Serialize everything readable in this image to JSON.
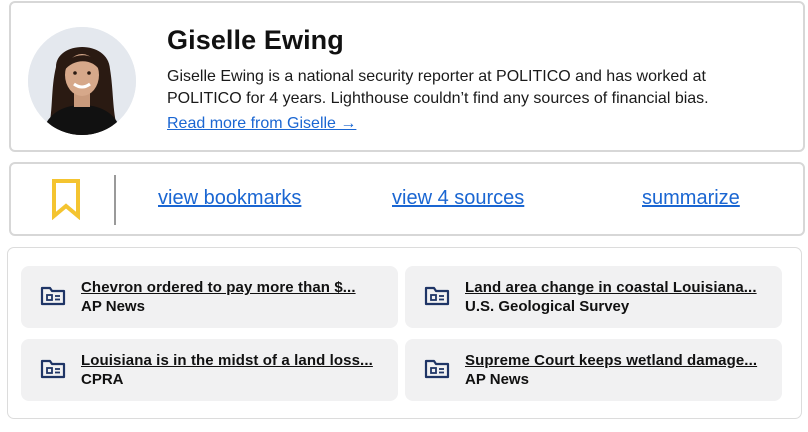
{
  "author": {
    "name": "Giselle Ewing",
    "bio": "Giselle Ewing is a national security reporter at POLITICO and has worked at POLITICO for 4 years. Lighthouse couldn’t find any sources of financial bias.",
    "read_more": "Read more from Giselle →",
    "avatar_icon": "person-photo"
  },
  "actions": {
    "bookmark_icon": "bookmark-icon",
    "view_bookmarks": "view bookmarks",
    "view_sources": "view 4 sources",
    "summarize": "summarize"
  },
  "sources": [
    {
      "title": "Chevron ordered to pay more than $...",
      "outlet": "AP News",
      "icon": "folder-id-icon"
    },
    {
      "title": "Land area change in coastal Louisiana...",
      "outlet": "U.S. Geological Survey",
      "icon": "folder-id-icon"
    },
    {
      "title": "Louisiana is in the midst of a land loss...",
      "outlet": "CPRA",
      "icon": "folder-id-icon"
    },
    {
      "title": "Supreme Court keeps wetland damage...",
      "outlet": "AP News",
      "icon": "folder-id-icon"
    }
  ],
  "colors": {
    "link": "#1a66d2",
    "bookmark": "#f4c430",
    "icon_navy": "#1f3566",
    "card_border": "#d7d7d7",
    "source_bg": "#f1f1f2"
  }
}
